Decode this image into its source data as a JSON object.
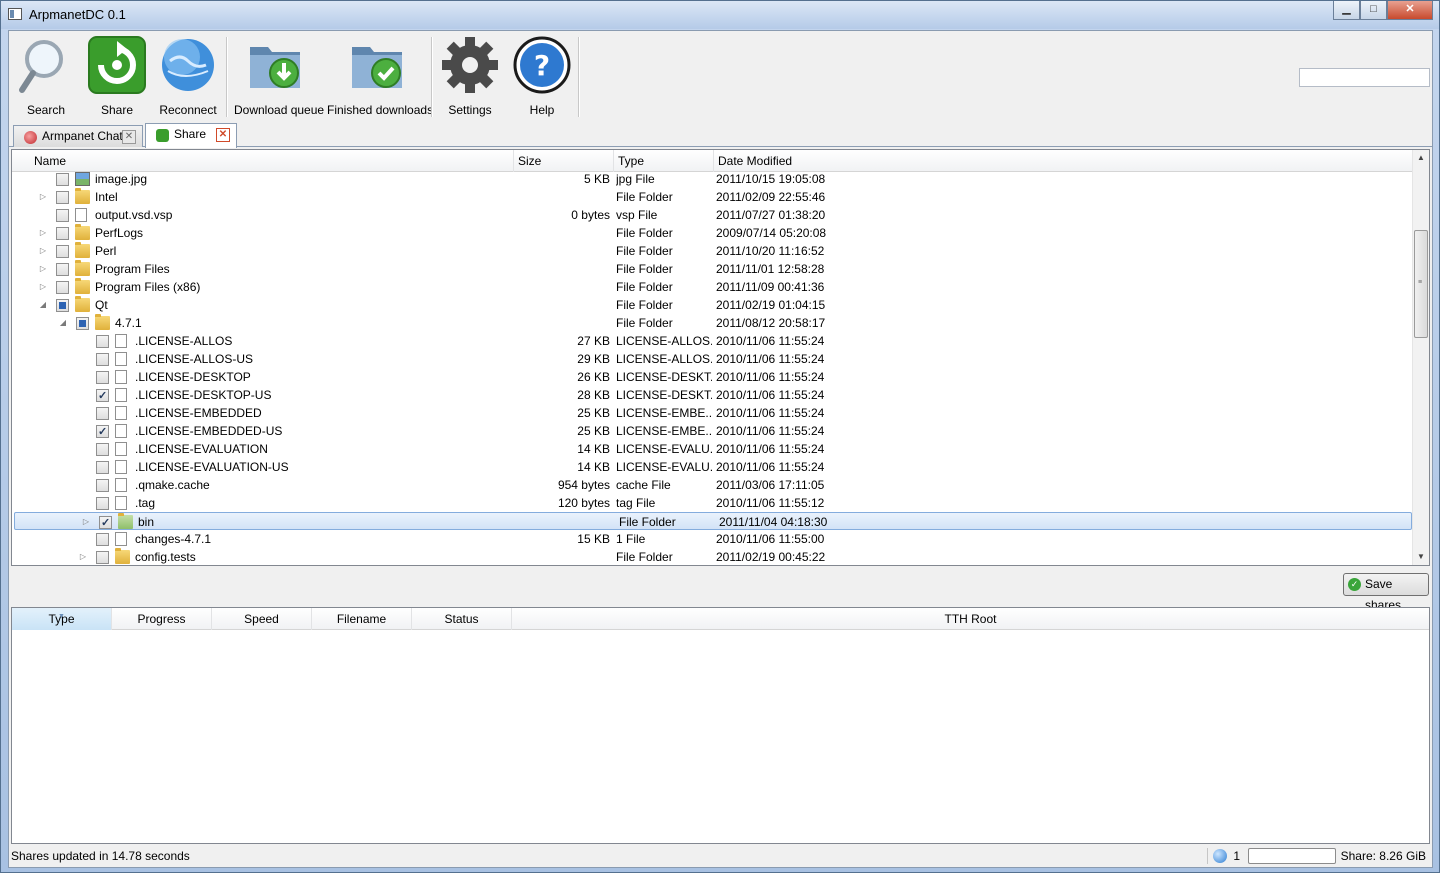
{
  "window": {
    "title": "ArpmanetDC 0.1",
    "controls": {
      "minimize": "▁",
      "maximize": "□",
      "close": "✕"
    }
  },
  "toolbar": {
    "buttons": [
      {
        "label": "Search",
        "icon": "magnifier-icon"
      },
      {
        "label": "Share",
        "icon": "share-sync-icon"
      },
      {
        "label": "Reconnect",
        "icon": "globe-icon"
      },
      {
        "label": "Download queue",
        "icon": "folder-download-icon"
      },
      {
        "label": "Finished downloads",
        "icon": "folder-check-icon"
      },
      {
        "label": "Settings",
        "icon": "gear-icon"
      },
      {
        "label": "Help",
        "icon": "help-icon"
      }
    ],
    "search_value": ""
  },
  "tabs": [
    {
      "label": "Armpanet Chat",
      "active": false
    },
    {
      "label": "Share",
      "active": true
    }
  ],
  "share_tree": {
    "columns": [
      "Name",
      "Size",
      "Type",
      "Date Modified"
    ],
    "rows": [
      {
        "depth": 0,
        "expander": "",
        "check": "none",
        "icon": "image",
        "name": "image.jpg",
        "size": "5 KB",
        "type": "jpg File",
        "date": "2011/10/15 19:05:08"
      },
      {
        "depth": 0,
        "expander": "▷",
        "check": "none",
        "icon": "folder",
        "name": "Intel",
        "size": "",
        "type": "File Folder",
        "date": "2011/02/09 22:55:46"
      },
      {
        "depth": 0,
        "expander": "",
        "check": "none",
        "icon": "file",
        "name": "output.vsd.vsp",
        "size": "0 bytes",
        "type": "vsp File",
        "date": "2011/07/27 01:38:20"
      },
      {
        "depth": 0,
        "expander": "▷",
        "check": "none",
        "icon": "folder",
        "name": "PerfLogs",
        "size": "",
        "type": "File Folder",
        "date": "2009/07/14 05:20:08"
      },
      {
        "depth": 0,
        "expander": "▷",
        "check": "none",
        "icon": "folder",
        "name": "Perl",
        "size": "",
        "type": "File Folder",
        "date": "2011/10/20 11:16:52"
      },
      {
        "depth": 0,
        "expander": "▷",
        "check": "none",
        "icon": "folder",
        "name": "Program Files",
        "size": "",
        "type": "File Folder",
        "date": "2011/11/01 12:58:28"
      },
      {
        "depth": 0,
        "expander": "▷",
        "check": "none",
        "icon": "folder",
        "name": "Program Files (x86)",
        "size": "",
        "type": "File Folder",
        "date": "2011/11/09 00:41:36"
      },
      {
        "depth": 0,
        "expander": "◢",
        "check": "partial",
        "icon": "folder",
        "name": "Qt",
        "size": "",
        "type": "File Folder",
        "date": "2011/02/19 01:04:15"
      },
      {
        "depth": 1,
        "expander": "◢",
        "check": "partial",
        "icon": "folder",
        "name": "4.7.1",
        "size": "",
        "type": "File Folder",
        "date": "2011/08/12 20:58:17"
      },
      {
        "depth": 2,
        "expander": "",
        "check": "none",
        "icon": "file",
        "name": ".LICENSE-ALLOS",
        "size": "27 KB",
        "type": "LICENSE-ALLOS...",
        "date": "2010/11/06 11:55:24"
      },
      {
        "depth": 2,
        "expander": "",
        "check": "none",
        "icon": "file",
        "name": ".LICENSE-ALLOS-US",
        "size": "29 KB",
        "type": "LICENSE-ALLOS...",
        "date": "2010/11/06 11:55:24"
      },
      {
        "depth": 2,
        "expander": "",
        "check": "none",
        "icon": "file",
        "name": ".LICENSE-DESKTOP",
        "size": "26 KB",
        "type": "LICENSE-DESKT...",
        "date": "2010/11/06 11:55:24"
      },
      {
        "depth": 2,
        "expander": "",
        "check": "checked",
        "icon": "file",
        "name": ".LICENSE-DESKTOP-US",
        "size": "28 KB",
        "type": "LICENSE-DESKT...",
        "date": "2010/11/06 11:55:24"
      },
      {
        "depth": 2,
        "expander": "",
        "check": "none",
        "icon": "file",
        "name": ".LICENSE-EMBEDDED",
        "size": "25 KB",
        "type": "LICENSE-EMBE...",
        "date": "2010/11/06 11:55:24"
      },
      {
        "depth": 2,
        "expander": "",
        "check": "checked",
        "icon": "file",
        "name": ".LICENSE-EMBEDDED-US",
        "size": "25 KB",
        "type": "LICENSE-EMBE...",
        "date": "2010/11/06 11:55:24"
      },
      {
        "depth": 2,
        "expander": "",
        "check": "none",
        "icon": "file",
        "name": ".LICENSE-EVALUATION",
        "size": "14 KB",
        "type": "LICENSE-EVALU...",
        "date": "2010/11/06 11:55:24"
      },
      {
        "depth": 2,
        "expander": "",
        "check": "none",
        "icon": "file",
        "name": ".LICENSE-EVALUATION-US",
        "size": "14 KB",
        "type": "LICENSE-EVALU...",
        "date": "2010/11/06 11:55:24"
      },
      {
        "depth": 2,
        "expander": "",
        "check": "none",
        "icon": "file",
        "name": ".qmake.cache",
        "size": "954 bytes",
        "type": "cache File",
        "date": "2011/03/06 17:11:05"
      },
      {
        "depth": 2,
        "expander": "",
        "check": "none",
        "icon": "file",
        "name": ".tag",
        "size": "120 bytes",
        "type": "tag File",
        "date": "2010/11/06 11:55:12"
      },
      {
        "depth": 2,
        "expander": "▷",
        "check": "checked",
        "icon": "folder-green",
        "name": "bin",
        "size": "",
        "type": "File Folder",
        "date": "2011/11/04 04:18:30",
        "selected": true
      },
      {
        "depth": 2,
        "expander": "",
        "check": "none",
        "icon": "file",
        "name": "changes-4.7.1",
        "size": "15 KB",
        "type": "1 File",
        "date": "2010/11/06 11:55:00"
      },
      {
        "depth": 2,
        "expander": "▷",
        "check": "none",
        "icon": "folder",
        "name": "config.tests",
        "size": "",
        "type": "File Folder",
        "date": "2011/02/19 00:45:22"
      }
    ]
  },
  "save_button": {
    "label": "Save shares"
  },
  "transfers": {
    "columns": [
      "Type",
      "Progress",
      "Speed",
      "Filename",
      "Status",
      "TTH Root"
    ],
    "sorted_column": "Type"
  },
  "status": {
    "text": "Shares updated in 14.78 seconds",
    "peer_count": "1",
    "share_size": "Share: 8.26 GiB"
  },
  "colors": {
    "accent": "#2d63b3",
    "selection_border": "#84acdd",
    "folder": "#e0b13b"
  }
}
